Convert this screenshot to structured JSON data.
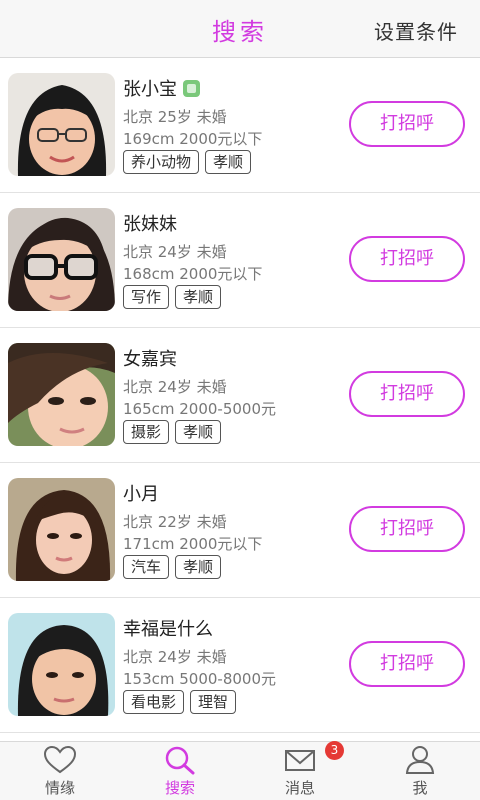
{
  "header": {
    "title": "搜索",
    "settings_label": "设置条件"
  },
  "profiles": [
    {
      "name": "张小宝",
      "verified": true,
      "city_age_status": "北京 25岁 未婚",
      "height_income": "169cm 2000元以下",
      "tags": [
        "养小动物",
        "孝顺"
      ],
      "greet_label": "打招呼"
    },
    {
      "name": "张妹妹",
      "verified": false,
      "city_age_status": "北京 24岁 未婚",
      "height_income": "168cm 2000元以下",
      "tags": [
        "写作",
        "孝顺"
      ],
      "greet_label": "打招呼"
    },
    {
      "name": "女嘉宾",
      "verified": false,
      "city_age_status": "北京 24岁 未婚",
      "height_income": "165cm 2000-5000元",
      "tags": [
        "摄影",
        "孝顺"
      ],
      "greet_label": "打招呼"
    },
    {
      "name": "小月",
      "verified": false,
      "city_age_status": "北京 22岁 未婚",
      "height_income": "171cm 2000元以下",
      "tags": [
        "汽车",
        "孝顺"
      ],
      "greet_label": "打招呼"
    },
    {
      "name": "幸福是什么",
      "verified": false,
      "city_age_status": "北京 24岁 未婚",
      "height_income": "153cm 5000-8000元",
      "tags": [
        "看电影",
        "理智"
      ],
      "greet_label": "打招呼"
    }
  ],
  "nav": {
    "items": [
      {
        "label": "情缘",
        "icon": "heart-icon",
        "active": false
      },
      {
        "label": "搜索",
        "icon": "search-icon",
        "active": true
      },
      {
        "label": "消息",
        "icon": "mail-icon",
        "active": false
      },
      {
        "label": "我",
        "icon": "person-icon",
        "active": false
      }
    ],
    "message_badge": "3"
  },
  "colors": {
    "accent": "#d23be0",
    "badge": "#e53935"
  }
}
